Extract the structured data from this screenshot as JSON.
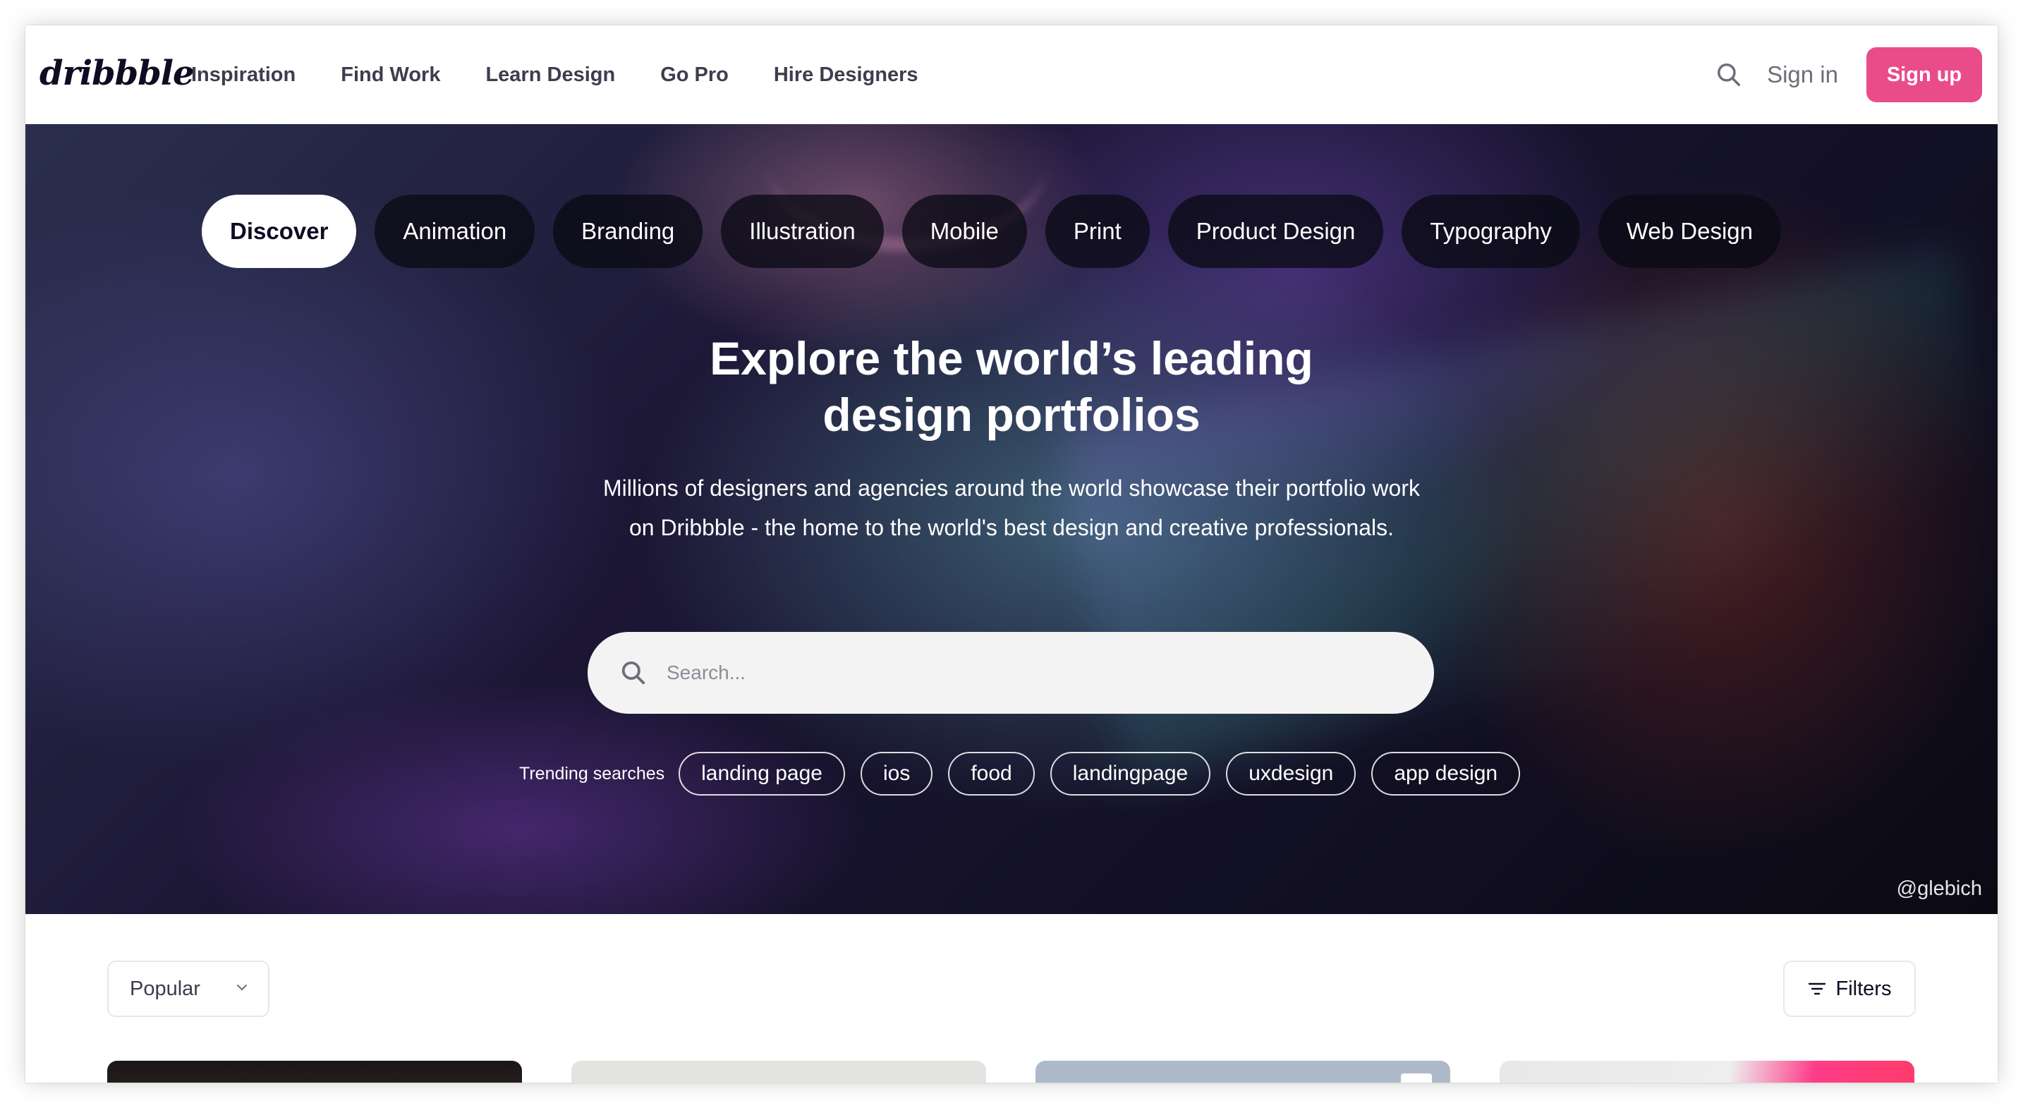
{
  "brand": {
    "logo_text": "dribbble",
    "accent_color": "#ea4c89"
  },
  "nav": {
    "items": [
      "Inspiration",
      "Find Work",
      "Learn Design",
      "Go Pro",
      "Hire Designers"
    ]
  },
  "header": {
    "signin_label": "Sign in",
    "signup_label": "Sign up",
    "search_icon": "search-icon"
  },
  "hero": {
    "tabs": [
      "Discover",
      "Animation",
      "Branding",
      "Illustration",
      "Mobile",
      "Print",
      "Product Design",
      "Typography",
      "Web Design"
    ],
    "active_tab": "Discover",
    "title_line1": "Explore the world’s leading",
    "title_line2": "design portfolios",
    "subtitle_line1": "Millions of designers and agencies around the world showcase their portfolio work",
    "subtitle_line2": "on Dribbble - the home to the world's best design and creative professionals.",
    "search_placeholder": "Search...",
    "trending_label": "Trending searches",
    "trending": [
      "landing page",
      "ios",
      "food",
      "landingpage",
      "uxdesign",
      "app design"
    ],
    "credit": "@glebich"
  },
  "feed": {
    "sort_label": "Popular",
    "filters_label": "Filters"
  }
}
